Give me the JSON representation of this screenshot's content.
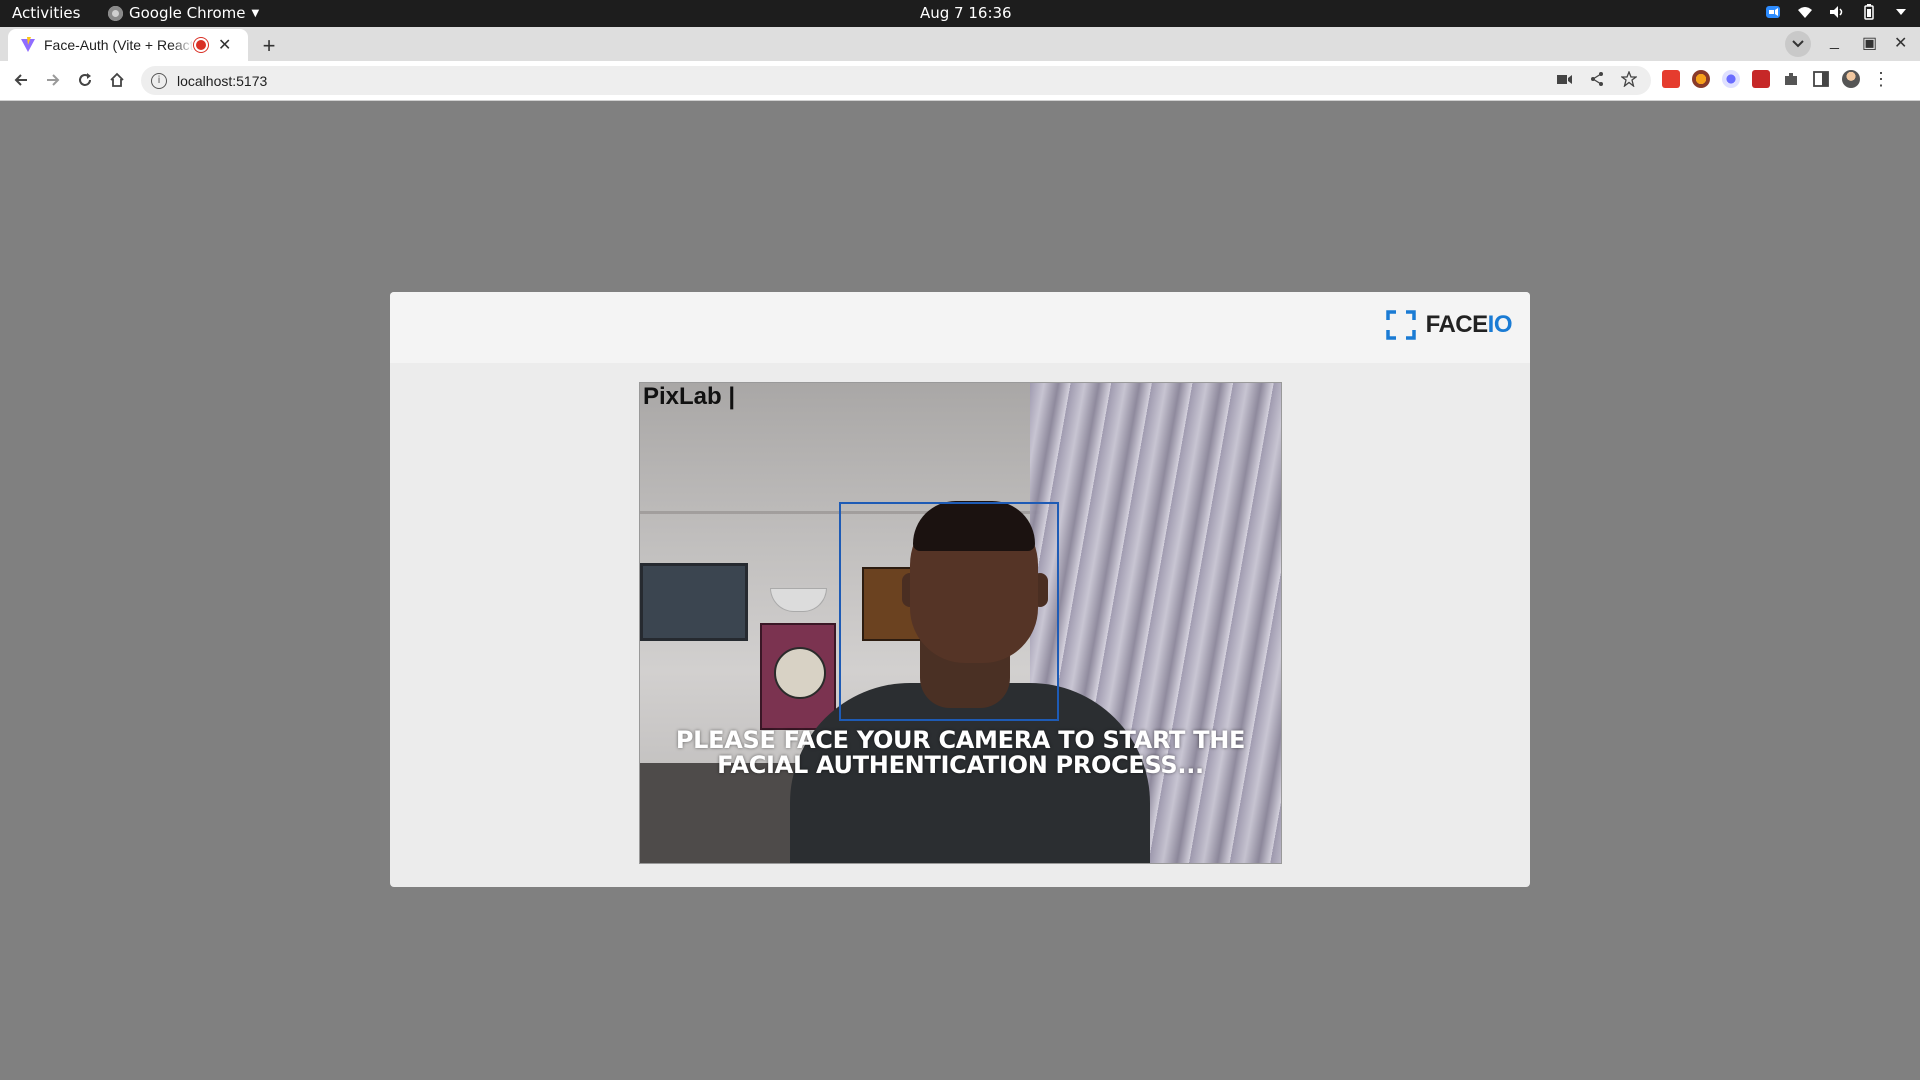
{
  "system_bar": {
    "activities": "Activities",
    "app_name": "Google Chrome",
    "clock": "Aug 7  16:36"
  },
  "browser": {
    "tab_title": "Face-Auth (Vite + React",
    "url": "localhost:5173"
  },
  "modal": {
    "logo_face": "FACE",
    "logo_io": "IO",
    "camera_watermark": "PixLab |",
    "instruction": "PLEASE FACE YOUR CAMERA TO START THE FACIAL AUTHENTICATION PROCESS..."
  },
  "colors": {
    "page_background": "#808080",
    "modal_background": "#ececec",
    "brand_blue": "#1a7bd4",
    "face_box": "#1e5bb5"
  }
}
